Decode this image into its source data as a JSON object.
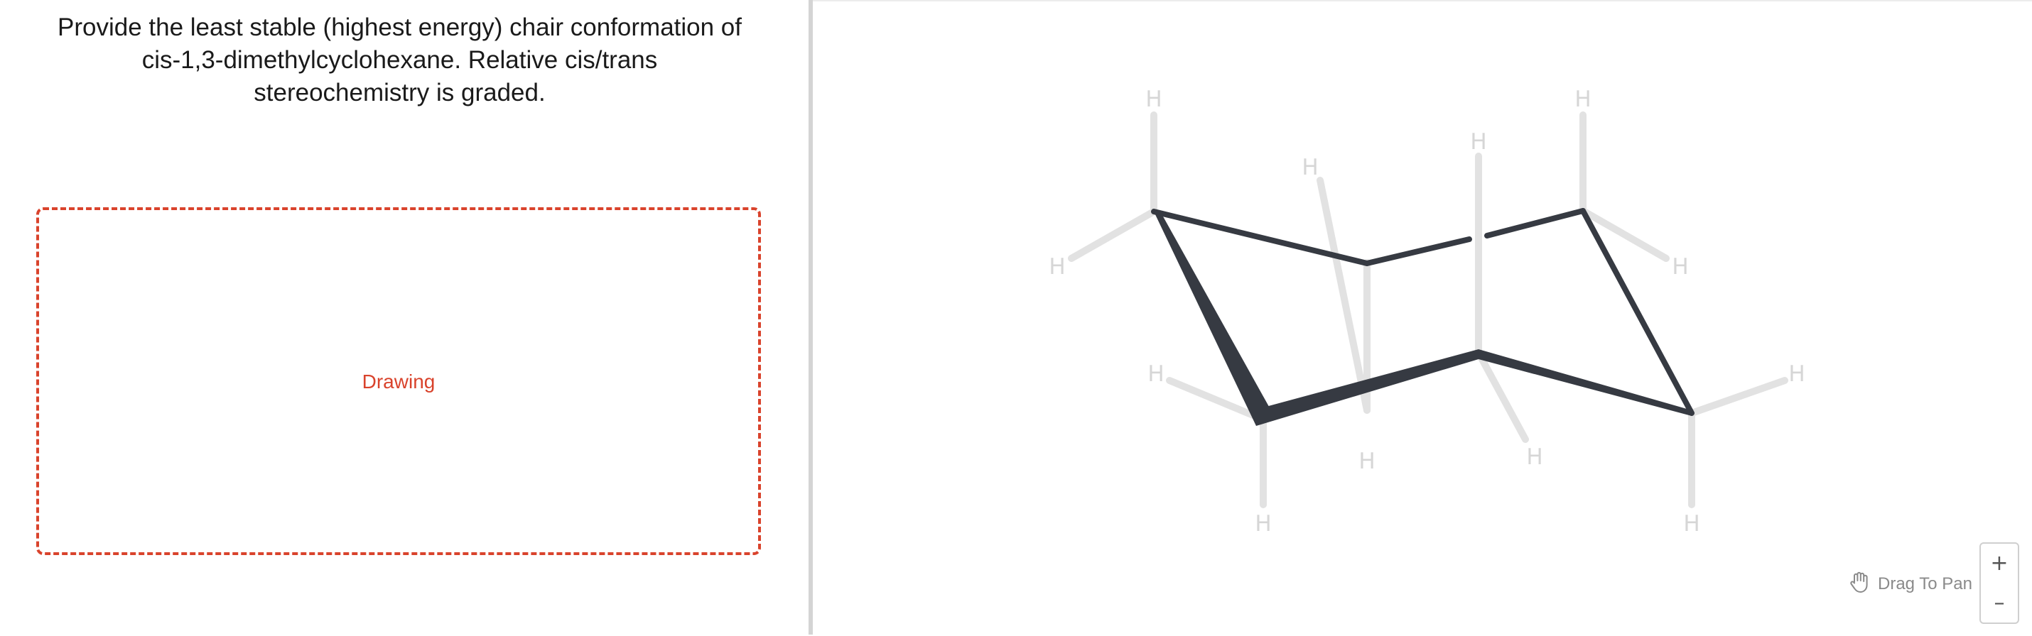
{
  "question": {
    "line1": "Provide the least stable (highest energy) chair conformation of",
    "line2": "cis-1,3-dimethylcyclohexane. Relative cis/trans",
    "line3": "stereochemistry is graded."
  },
  "drawing": {
    "label": "Drawing",
    "border_color": "#d9432c"
  },
  "molecule": {
    "hydrogen_label": "H",
    "bond_color": "#363a42",
    "hydrogen_color": "#d6d6d6"
  },
  "canvas": {
    "pan_label": "Drag To Pan",
    "pan_icon": "hand-icon",
    "zoom_in_label": "+",
    "zoom_out_label": "–"
  }
}
